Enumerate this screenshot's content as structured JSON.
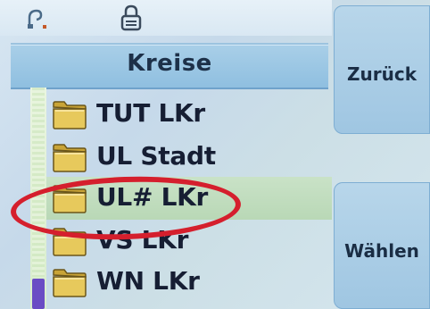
{
  "status": {
    "signal_icon": "signal-icon",
    "lock_icon": "lock-icon"
  },
  "header": {
    "title": "Kreise"
  },
  "list": {
    "items": [
      {
        "label": "TUT LKr",
        "icon": "folder-icon",
        "selected": false
      },
      {
        "label": "UL Stadt",
        "icon": "folder-icon",
        "selected": false
      },
      {
        "label": "UL# LKr",
        "icon": "folder-icon",
        "selected": true
      },
      {
        "label": "VS LKr",
        "icon": "folder-icon",
        "selected": false
      },
      {
        "label": "WN LKr",
        "icon": "folder-icon",
        "selected": false
      }
    ]
  },
  "softkeys": {
    "back_label": "Zurück",
    "select_label": "Wählen"
  },
  "colors": {
    "header": "#9cc6e4",
    "selection": "#c2dfc0",
    "highlight_ring": "#d51f2d",
    "scroll_thumb": "#6a4cc4"
  }
}
